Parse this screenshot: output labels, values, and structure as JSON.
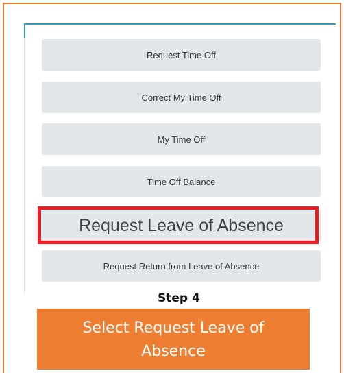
{
  "menu": {
    "items": [
      {
        "label": "Request Time Off"
      },
      {
        "label": "Correct My Time Off"
      },
      {
        "label": "My Time Off"
      },
      {
        "label": "Time Off Balance"
      },
      {
        "label": "Request Leave of Absence"
      },
      {
        "label": "Request Return from Leave of Absence"
      }
    ]
  },
  "step": {
    "label": "Step 4",
    "instruction": "Select Request Leave of Absence"
  },
  "colors": {
    "frame_border": "#ED7D31",
    "panel_accent": "#2E9FB5",
    "button_bg": "#E4E7EA",
    "highlight": "#ED1C24",
    "instruction_bg": "#ED7D31"
  }
}
